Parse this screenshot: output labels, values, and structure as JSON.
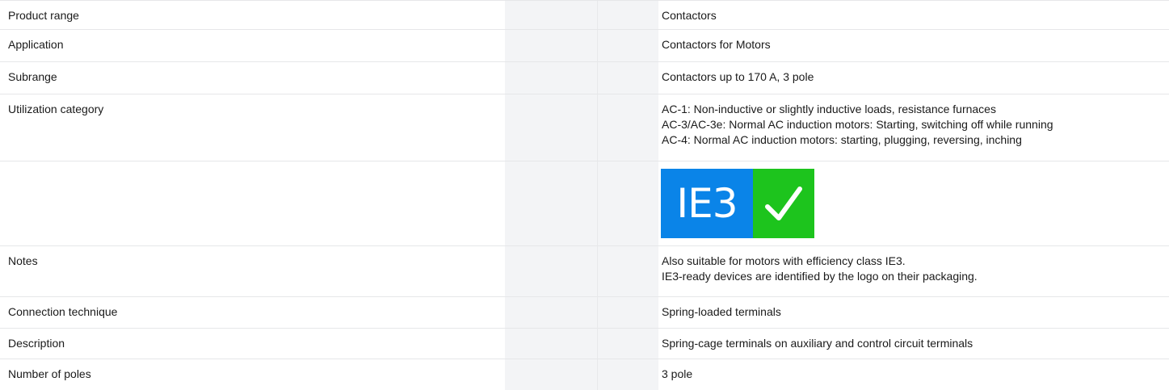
{
  "rows": [
    {
      "label": "Product range",
      "lines": [
        "Contactors"
      ]
    },
    {
      "label": "Application",
      "lines": [
        "Contactors for Motors"
      ]
    },
    {
      "label": "Subrange",
      "lines": [
        "Contactors up to 170 A, 3 pole"
      ]
    },
    {
      "label": "Utilization category",
      "lines": [
        "AC-1: Non-inductive or slightly inductive loads, resistance furnaces",
        "AC-3/AC-3e: Normal AC induction motors: Starting, switching off while running",
        "AC-4: Normal AC induction motors: starting, plugging, reversing, inching"
      ]
    },
    {
      "label": "",
      "logo": {
        "text": "IE3",
        "icon": "checkmark-icon",
        "text_bg": "#0a84e8",
        "check_bg": "#1dc41d"
      }
    },
    {
      "label": "Notes",
      "lines": [
        "Also suitable for motors with efficiency class IE3.",
        "IE3-ready devices are identified by the logo on their packaging."
      ]
    },
    {
      "label": "Connection technique",
      "lines": [
        "Spring-loaded terminals"
      ]
    },
    {
      "label": "Description",
      "lines": [
        "Spring-cage terminals on auxiliary and control circuit terminals"
      ]
    },
    {
      "label": "Number of poles",
      "lines": [
        "3 pole"
      ]
    }
  ]
}
